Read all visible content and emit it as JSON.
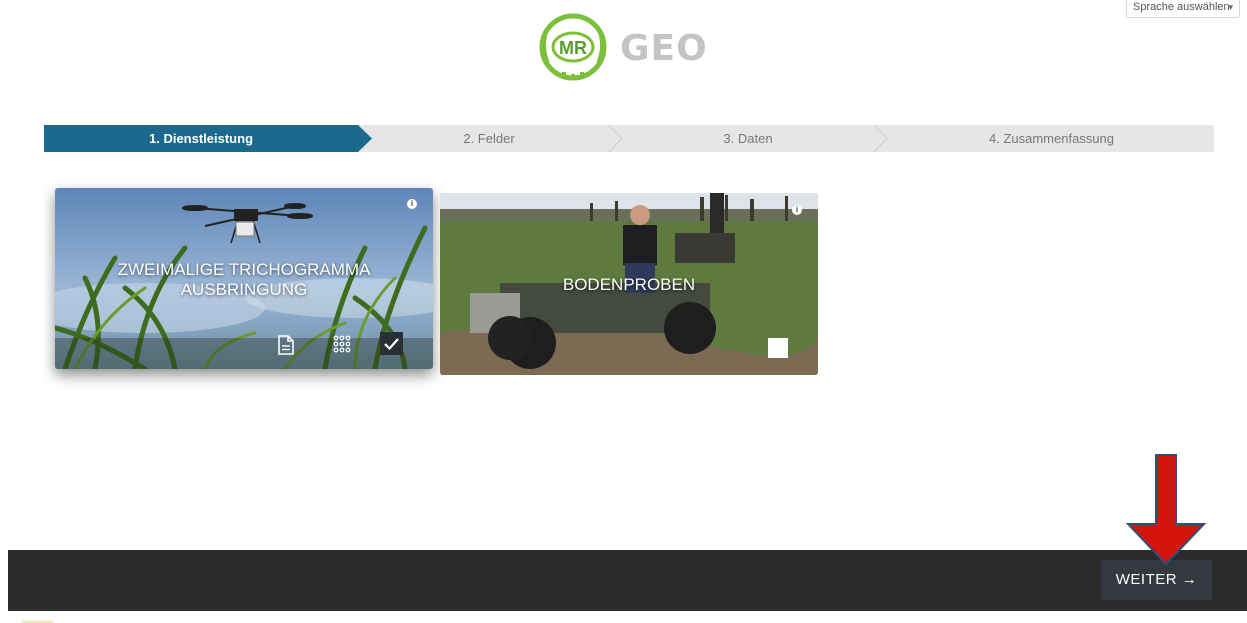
{
  "language_select": {
    "label": "Sprache auswählen"
  },
  "logo": {
    "mark_text": "MR",
    "word": "GEO"
  },
  "stepper": {
    "steps": [
      {
        "label": "1. Dienstleistung",
        "active": true
      },
      {
        "label": "2. Felder",
        "active": false
      },
      {
        "label": "3. Daten",
        "active": false
      },
      {
        "label": "4. Zusammenfassung",
        "active": false
      }
    ],
    "active_color": "#1b6a8e",
    "inactive_color": "#e6e6e6"
  },
  "services": [
    {
      "title_line1": "ZWEIMALIGE TRICHOGRAMMA",
      "title_line2": "AUSBRINGUNG",
      "selected": true,
      "actions": [
        "document-icon",
        "grid-dots-icon",
        "checkmark-icon"
      ]
    },
    {
      "title_line1": "BODENPROBEN",
      "selected": false,
      "actions": [
        "checkbox-icon"
      ]
    }
  ],
  "footer": {
    "next_label": "WEITER →"
  },
  "annotation": {
    "arrow_color": "#d4150d"
  }
}
